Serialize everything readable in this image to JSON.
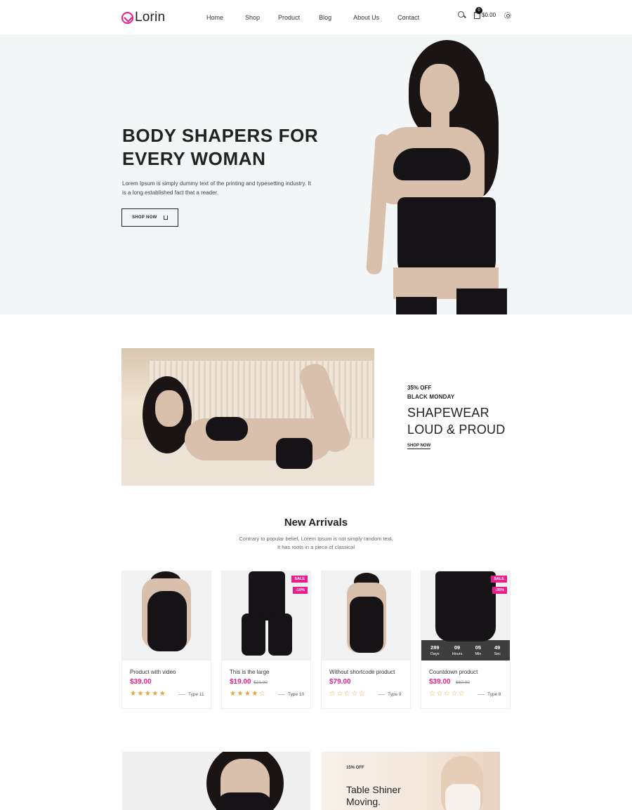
{
  "header": {
    "logo": "Lorin",
    "nav": [
      "Home",
      "Shop",
      "Product",
      "Blog",
      "About Us",
      "Contact"
    ],
    "cart_count": "0",
    "cart_total": "$0.00"
  },
  "hero": {
    "title_line1": "BODY SHAPERS FOR",
    "title_line2": "EVERY WOMAN",
    "text": "Lorem Ipsum is simply dummy text of the printing and typesetting industry. It is a long established fact that a reader.",
    "button": "SHOP NOW"
  },
  "promo": {
    "discount": "35% OFF",
    "event": "BLACK MONDAY",
    "title_line1": "SHAPEWEAR",
    "title_line2": "LOUD & PROUD",
    "link": "SHOP NOW"
  },
  "new_arrivals": {
    "title": "New Arrivals",
    "subtitle": "Contrary to popular belief, Lorem Ipsum is not simply random text. It has roots in a piece of classical",
    "products": [
      {
        "name": "Product with video",
        "price": "$39.00",
        "old_price": "",
        "rating": 5,
        "stars": "★★★★★",
        "type": "Type 11",
        "badges": []
      },
      {
        "name": "This is the large",
        "price": "$19.00",
        "old_price": "$21.00",
        "rating": 4.5,
        "stars": "★★★★☆",
        "type": "Type 10",
        "badges": [
          "SALE",
          "-10%"
        ]
      },
      {
        "name": "Without shortcode product",
        "price": "$79.00",
        "old_price": "",
        "rating": 0,
        "stars": "☆☆☆☆☆",
        "type": "Type 9",
        "badges": []
      },
      {
        "name": "Countdown product",
        "price": "$39.00",
        "old_price": "$60.00",
        "rating": 0,
        "stars": "☆☆☆☆☆",
        "type": "Type 8",
        "badges": [
          "SALE",
          "-35%"
        ],
        "countdown": [
          {
            "value": "289",
            "label": "Days"
          },
          {
            "value": "09",
            "label": "Hours"
          },
          {
            "value": "05",
            "label": "Min"
          },
          {
            "value": "49",
            "label": "Sec"
          }
        ]
      }
    ]
  },
  "bottom_banner": {
    "discount": "15% OFF",
    "title_line1": "Table Shiner",
    "title_line2": "Moving."
  },
  "colors": {
    "accent": "#e91e8c",
    "star": "#e3a43c",
    "hero_bg": "#f2f6f7"
  }
}
